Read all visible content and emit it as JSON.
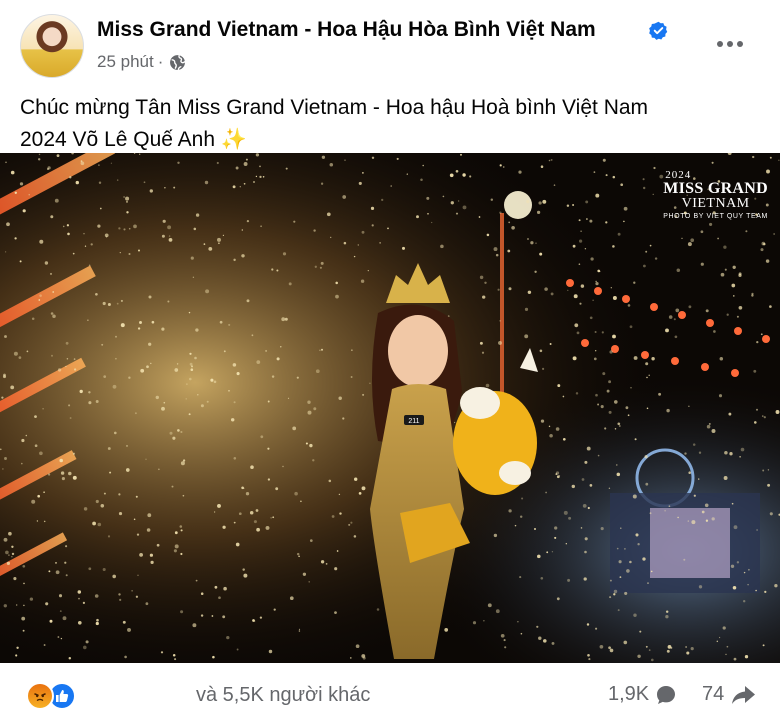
{
  "post": {
    "page_name": "Miss Grand Vietnam - Hoa Hậu Hòa Bình Việt Nam",
    "time": "25 phút",
    "separator": "·",
    "privacy_icon": "globe-icon",
    "verified_icon": "verified-badge-icon",
    "text_line1": "Chúc mừng Tân Miss Grand Vietnam - Hoa hậu Hoà bình Việt Nam",
    "text_line2": "2024 Võ Lê Quế Anh",
    "text_emoji": "✨"
  },
  "photo": {
    "watermark_year": "2024",
    "watermark_title": "MISS GRAND",
    "watermark_sub": "VIETNAM",
    "watermark_credit": "PHOTO BY VIET QUY TEAM",
    "contestant_number": "211"
  },
  "footer": {
    "reaction_icons": [
      "angry-icon",
      "like-icon"
    ],
    "reaction_text": "và 5,5K người khác",
    "comments": "1,9K",
    "shares": "74"
  },
  "colors": {
    "accent": "#1877f2",
    "muted_text": "#65676b",
    "angry": "#f0890f"
  }
}
